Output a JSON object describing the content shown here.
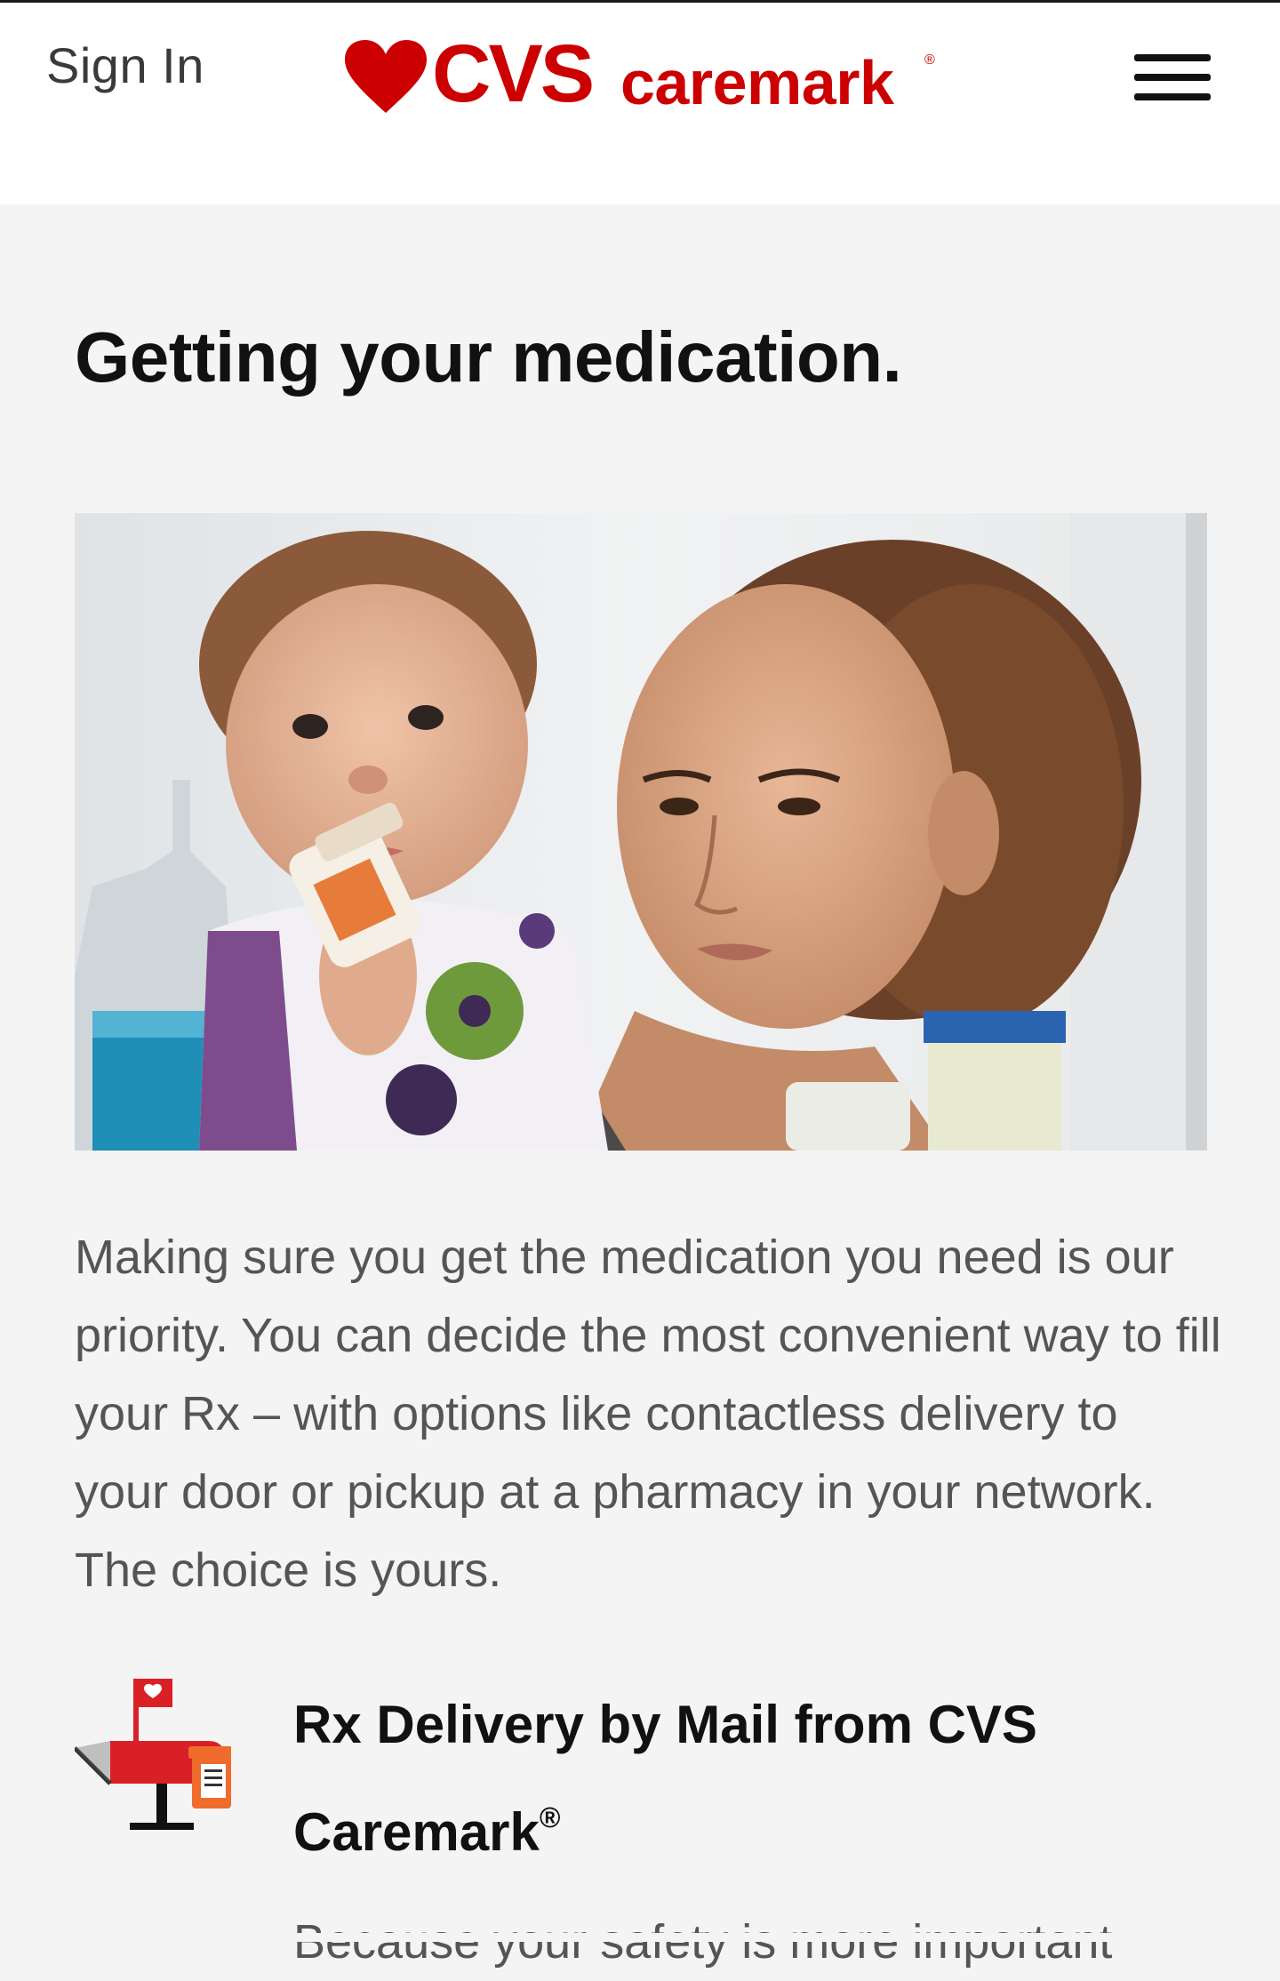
{
  "header": {
    "sign_in": "Sign In",
    "logo": {
      "brand": "CVS",
      "product": "caremark",
      "mark": "®"
    },
    "menu_icon": "hamburger-menu-icon"
  },
  "main": {
    "heading": "Getting your medication.",
    "hero_image_alt": "hero-photo",
    "intro": "Making sure you get the medication you need is our priority. You can decide the most convenient way to fill your Rx – with options like contactless delivery to your door or pickup at a pharmacy in your network. The choice is yours.",
    "delivery": {
      "icon": "mailbox-icon",
      "title": "Rx Delivery by Mail from CVS Caremark",
      "title_mark": "®",
      "body_start": "Because your safety is more important"
    }
  },
  "colors": {
    "brand_red": "#cc0000",
    "background": "#f4f4f4",
    "header": "#ffffff",
    "heading": "#111111",
    "body_text": "#555555"
  }
}
